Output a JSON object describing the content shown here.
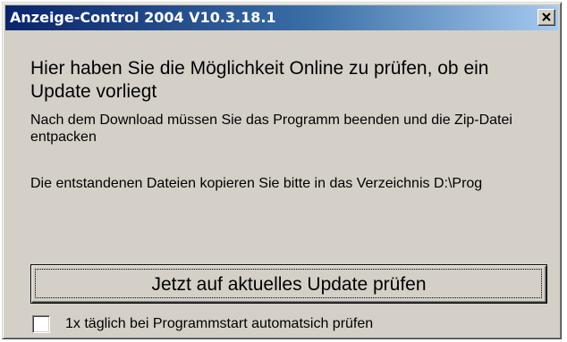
{
  "window": {
    "title": "Anzeige-Control 2004 V10.3.18.1",
    "close_icon": "close-icon"
  },
  "content": {
    "heading": "Hier haben Sie die Möglichkeit Online zu prüfen, ob ein Update vorliegt",
    "paragraph_1": "Nach dem Download müssen Sie das Programm beenden und die Zip-Datei entpacken",
    "paragraph_2": "Die entstandenen Dateien kopieren Sie bitte in das Verzeichnis D:\\Prog"
  },
  "actions": {
    "check_button_label": "Jetzt auf aktuelles Update prüfen",
    "auto_check_label": "1x täglich bei Programmstart automatsich prüfen",
    "auto_check_checked": false
  },
  "colors": {
    "title_gradient_start": "#0a246a",
    "title_gradient_end": "#a6caf0",
    "dialog_face": "#d4d0c8"
  }
}
